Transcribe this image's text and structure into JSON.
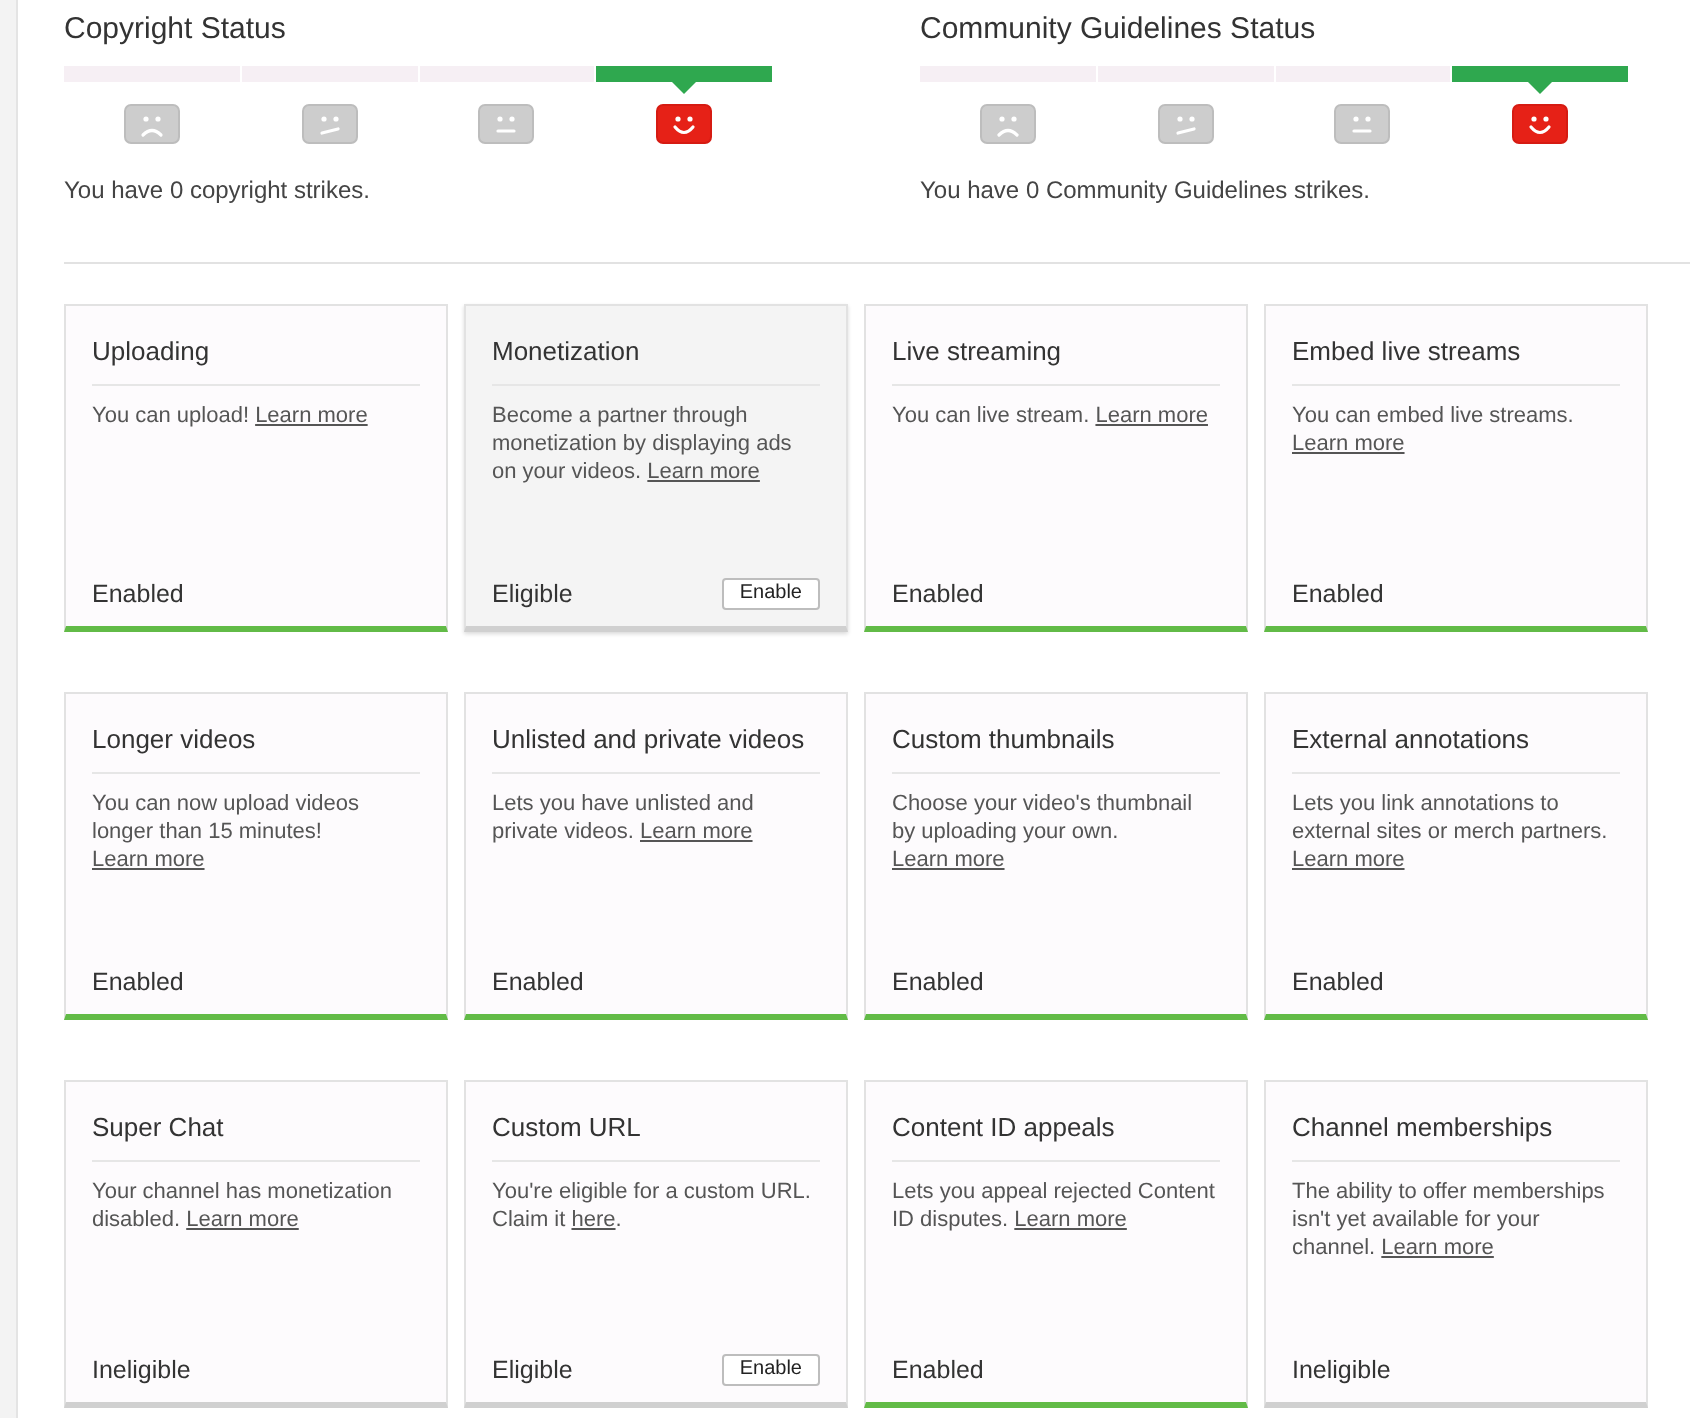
{
  "strike_statuses": [
    {
      "title": "Copyright Status",
      "segments": [
        {
          "kind": "sad",
          "selected": false
        },
        {
          "kind": "uneasy",
          "selected": false
        },
        {
          "kind": "neutral",
          "selected": false
        },
        {
          "kind": "happy",
          "selected": true
        }
      ],
      "summary": "You have 0 copyright strikes."
    },
    {
      "title": "Community Guidelines Status",
      "segments": [
        {
          "kind": "sad",
          "selected": false
        },
        {
          "kind": "uneasy",
          "selected": false
        },
        {
          "kind": "neutral",
          "selected": false
        },
        {
          "kind": "happy",
          "selected": true
        }
      ],
      "summary": "You have 0 Community Guidelines strikes."
    }
  ],
  "features": [
    {
      "title": "Uploading",
      "description": "You can upload!",
      "link": "Learn more",
      "status": "Enabled",
      "enabled": true,
      "hovered": false
    },
    {
      "title": "Monetization",
      "description": "Become a partner through monetization by displaying ads on your videos.",
      "link": "Learn more",
      "status": "Eligible",
      "enabled": false,
      "hovered": true,
      "button": "Enable"
    },
    {
      "title": "Live streaming",
      "description": "You can live stream.",
      "link": "Learn more",
      "status": "Enabled",
      "enabled": true,
      "hovered": false
    },
    {
      "title": "Embed live streams",
      "description": "You can embed live streams.",
      "link": "Learn more",
      "status": "Enabled",
      "enabled": true,
      "hovered": false
    },
    {
      "title": "Longer videos",
      "description": "You can now upload videos longer than 15 minutes!",
      "link": "Learn more",
      "status": "Enabled",
      "enabled": true,
      "hovered": false
    },
    {
      "title": "Unlisted and private videos",
      "description": "Lets you have unlisted and private videos.",
      "link": "Learn more",
      "status": "Enabled",
      "enabled": true,
      "hovered": false
    },
    {
      "title": "Custom thumbnails",
      "description": "Choose your video's thumbnail by uploading your own.",
      "link": "Learn more",
      "status": "Enabled",
      "enabled": true,
      "hovered": false
    },
    {
      "title": "External annotations",
      "description": "Lets you link annotations to external sites or merch partners.",
      "link": "Learn more",
      "status": "Enabled",
      "enabled": true,
      "hovered": false
    },
    {
      "title": "Super Chat",
      "description": "Your channel has monetization disabled.",
      "link": "Learn more",
      "status": "Ineligible",
      "enabled": false,
      "hovered": false
    },
    {
      "title": "Custom URL",
      "description": "You're eligible for a custom URL. Claim it",
      "link": "here",
      "after": ".",
      "status": "Eligible",
      "enabled": false,
      "hovered": false,
      "button": "Enable"
    },
    {
      "title": "Content ID appeals",
      "description": "Lets you appeal rejected Content ID disputes.",
      "link": "Learn more",
      "status": "Enabled",
      "enabled": true,
      "hovered": false
    },
    {
      "title": "Channel memberships",
      "description": "The ability to offer memberships isn't yet available for your channel.",
      "link": "Learn more",
      "status": "Ineligible",
      "enabled": false,
      "hovered": false
    }
  ]
}
